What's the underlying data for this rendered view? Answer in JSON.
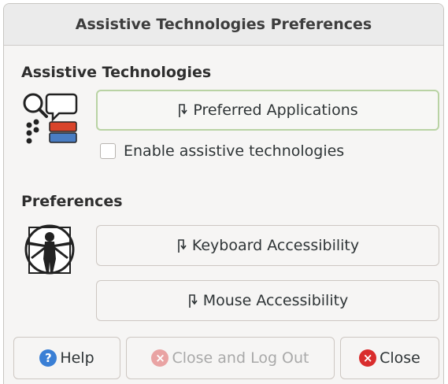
{
  "window": {
    "title": "Assistive Technologies Preferences"
  },
  "assistive": {
    "heading": "Assistive Technologies",
    "preferred_apps_label": "Preferred Applications",
    "enable_checkbox_label": "Enable assistive technologies",
    "enable_checked": false
  },
  "preferences": {
    "heading": "Preferences",
    "keyboard_label": "Keyboard Accessibility",
    "mouse_label": "Mouse Accessibility"
  },
  "footer": {
    "help_label": "Help",
    "close_logout_label": "Close and Log Out",
    "close_label": "Close"
  },
  "colors": {
    "help_icon": "#3a7fd5",
    "close_icon": "#d92d2d",
    "disabled_close_icon": "#e9a3a3",
    "focus_border": "#b9d3a4"
  },
  "icons": {
    "assistive": "assistive-technologies-icon",
    "preferences": "vitruvian-man-icon",
    "launch": "launch-arrow-icon",
    "help": "help-circle-icon",
    "close": "close-circle-icon"
  }
}
